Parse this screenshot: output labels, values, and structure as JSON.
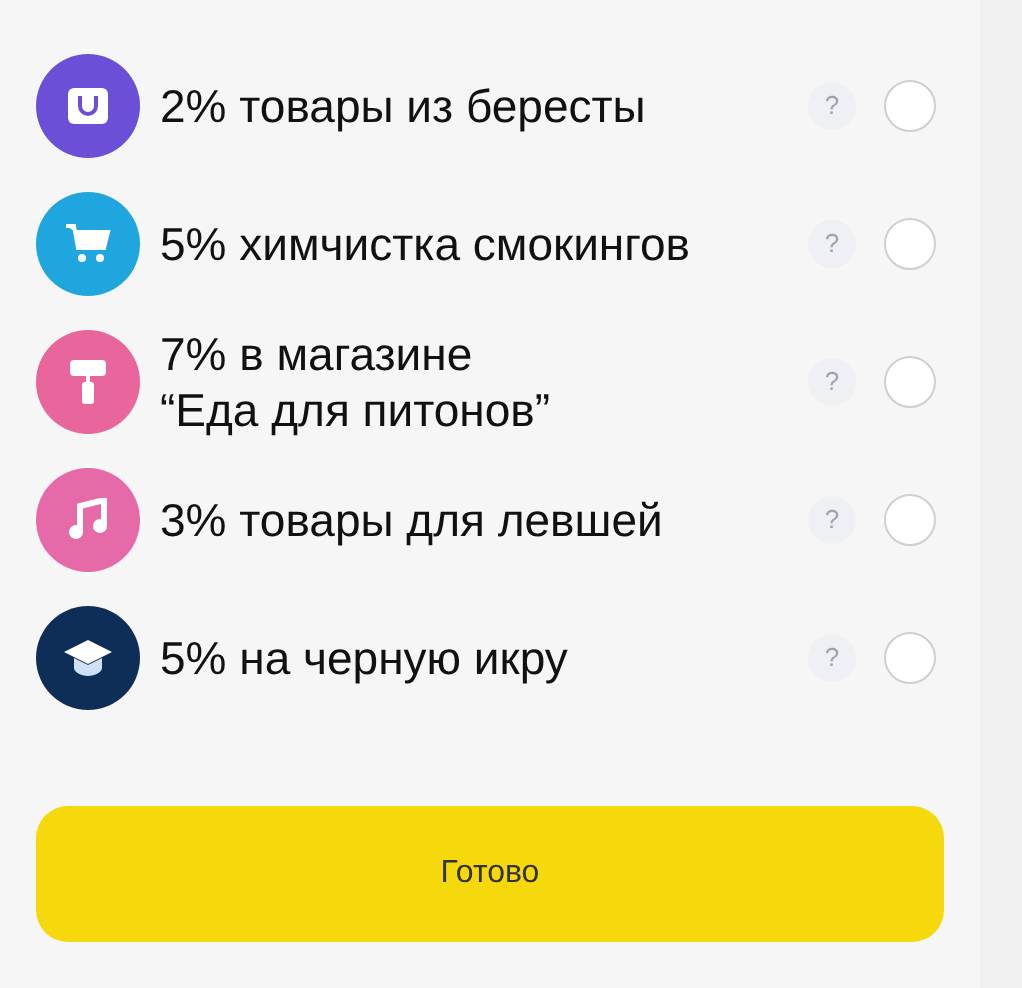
{
  "options": [
    {
      "kind": "bag",
      "color": "#6b4fd6",
      "lines": [
        "2% товары из бересты"
      ],
      "help": "?",
      "selected": false
    },
    {
      "kind": "cart",
      "color": "#1fa6de",
      "lines": [
        "5% химчистка смокингов"
      ],
      "help": "?",
      "selected": false
    },
    {
      "kind": "roller",
      "color": "#e8669c",
      "lines": [
        "7% в магазине",
        "“Еда для питонов”"
      ],
      "help": "?",
      "selected": false
    },
    {
      "kind": "music",
      "color": "#e66aa8",
      "lines": [
        "3% товары для левшей"
      ],
      "help": "?",
      "selected": false
    },
    {
      "kind": "cap",
      "color": "#0f2e57",
      "lines": [
        "5% на черную икру"
      ],
      "help": "?",
      "selected": false
    }
  ],
  "done_button": {
    "label": "Готово"
  }
}
